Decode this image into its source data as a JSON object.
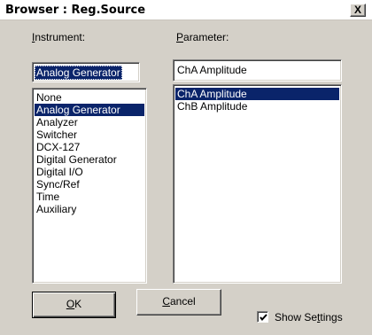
{
  "window": {
    "title": "Browser : Reg.Source",
    "close_glyph": "X"
  },
  "instrument": {
    "label_accel": "I",
    "label_rest": "nstrument:",
    "selected_value": "Analog Generator",
    "items": [
      "None",
      "Analog Generator",
      "Analyzer",
      "Switcher",
      "DCX-127",
      "Digital Generator",
      "Digital I/O",
      "Sync/Ref",
      "Time",
      "Auxiliary"
    ],
    "selected_index": 1
  },
  "parameter": {
    "label_accel": "P",
    "label_rest": "arameter:",
    "selected_value": "ChA Amplitude",
    "items": [
      "ChA Amplitude",
      "ChB Amplitude"
    ],
    "selected_index": 0
  },
  "buttons": {
    "ok_label": "OK",
    "cancel_label": "Cancel"
  },
  "show_settings": {
    "label_pre": "Show Se",
    "label_accel": "t",
    "label_post": "tings",
    "checked": true
  }
}
